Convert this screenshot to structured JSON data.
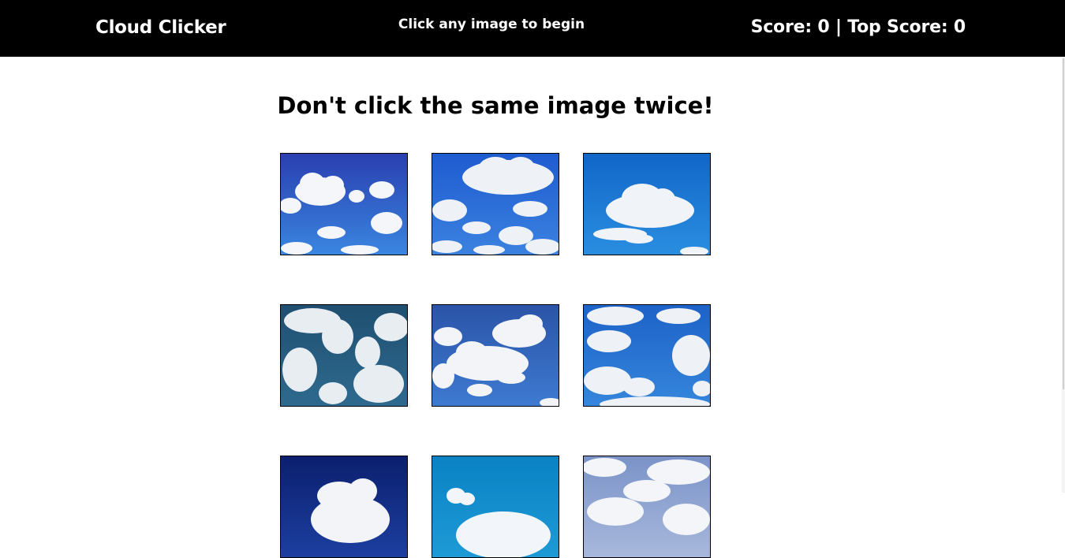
{
  "navbar": {
    "brand": "Cloud Clicker",
    "status": "Click any image to begin",
    "score_text": "Score: 0 | Top Score: 0"
  },
  "main": {
    "heading": "Don't click the same image twice!"
  },
  "tiles": [
    {
      "name": "cloud-image-1",
      "sky_top": "#2a3fb0",
      "sky_bottom": "#3a86e0"
    },
    {
      "name": "cloud-image-2",
      "sky_top": "#1e5bd0",
      "sky_bottom": "#3b82e0"
    },
    {
      "name": "cloud-image-3",
      "sky_top": "#1166c8",
      "sky_bottom": "#2a8ee0"
    },
    {
      "name": "cloud-image-4",
      "sky_top": "#1f4f70",
      "sky_bottom": "#2e6a8e"
    },
    {
      "name": "cloud-image-5",
      "sky_top": "#2b54a8",
      "sky_bottom": "#3d7ad0"
    },
    {
      "name": "cloud-image-6",
      "sky_top": "#1d62c8",
      "sky_bottom": "#3586dc"
    },
    {
      "name": "cloud-image-7",
      "sky_top": "#0b1f6e",
      "sky_bottom": "#1d3fa0"
    },
    {
      "name": "cloud-image-8",
      "sky_top": "#0a82c4",
      "sky_bottom": "#1e9ad6"
    },
    {
      "name": "cloud-image-9",
      "sky_top": "#7a93c8",
      "sky_bottom": "#a8b8dc"
    }
  ]
}
